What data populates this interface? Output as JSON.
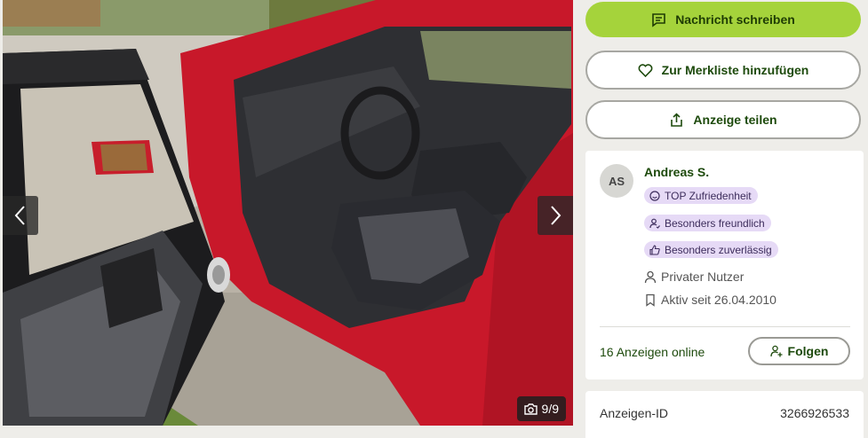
{
  "gallery": {
    "counter": "9/9",
    "icons": {
      "prev": "chevron-left-icon",
      "next": "chevron-right-icon",
      "camera": "camera-icon"
    }
  },
  "actions": {
    "message_label": "Nachricht schreiben",
    "watchlist_label": "Zur Merkliste hinzufügen",
    "share_label": "Anzeige teilen"
  },
  "seller": {
    "initials": "AS",
    "name": "Andreas S.",
    "badges": [
      "TOP Zufriedenheit",
      "Besonders freundlich",
      "Besonders zuverlässig"
    ],
    "type": "Privater Nutzer",
    "active_since": "Aktiv seit 26.04.2010",
    "ads_online": "16 Anzeigen online",
    "follow_label": "Folgen"
  },
  "ad": {
    "id_label": "Anzeigen-ID",
    "id_value": "3266926533"
  },
  "colors": {
    "primary": "#a5d33b",
    "text_green": "#1d4a0c",
    "badge_bg": "#e6daf6"
  }
}
